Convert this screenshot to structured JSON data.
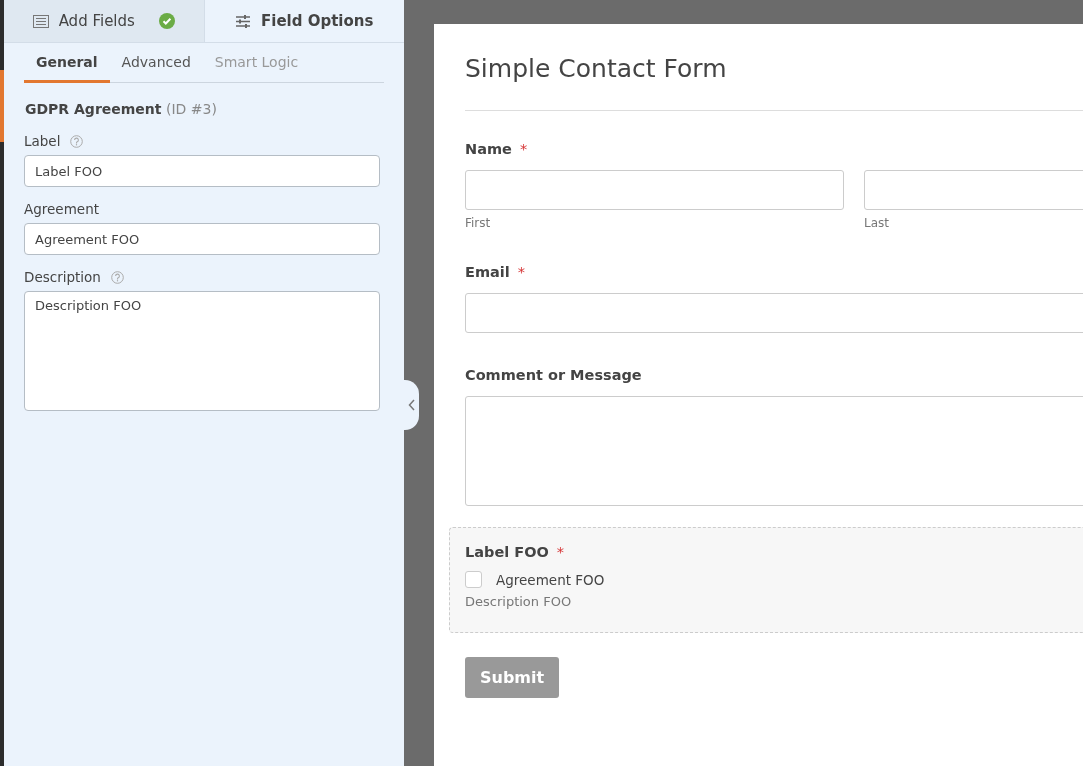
{
  "panel_tabs": [
    {
      "label": "Add Fields",
      "kind": "add",
      "selected": false
    },
    {
      "label": "Field Options",
      "kind": "options",
      "selected": true
    }
  ],
  "subtabs": [
    {
      "label": "General",
      "selected": true,
      "disabled": false
    },
    {
      "label": "Advanced",
      "selected": false,
      "disabled": false
    },
    {
      "label": "Smart Logic",
      "selected": false,
      "disabled": true
    }
  ],
  "field_name": "GDPR Agreement",
  "field_id": "(ID #3)",
  "options": [
    {
      "label": "Label",
      "help": true,
      "kind": "input",
      "value": "Label FOO"
    },
    {
      "label": "Agreement",
      "help": false,
      "kind": "input",
      "value": "Agreement FOO"
    },
    {
      "label": "Description",
      "help": true,
      "kind": "textarea",
      "value": "Description FOO"
    }
  ],
  "form": {
    "title": "Simple Contact Form",
    "fields": [
      {
        "kind": "name",
        "label": "Name",
        "required": true,
        "sublabels": [
          "First",
          "Last"
        ]
      },
      {
        "kind": "email",
        "label": "Email",
        "required": true
      },
      {
        "kind": "textarea",
        "label": "Comment or Message",
        "required": false
      },
      {
        "kind": "gdpr",
        "label": "Label FOO",
        "required": true,
        "agreement": "Agreement FOO",
        "checked": false,
        "description": "Description FOO"
      }
    ],
    "submit": "Submit",
    "required_mark": "*"
  }
}
